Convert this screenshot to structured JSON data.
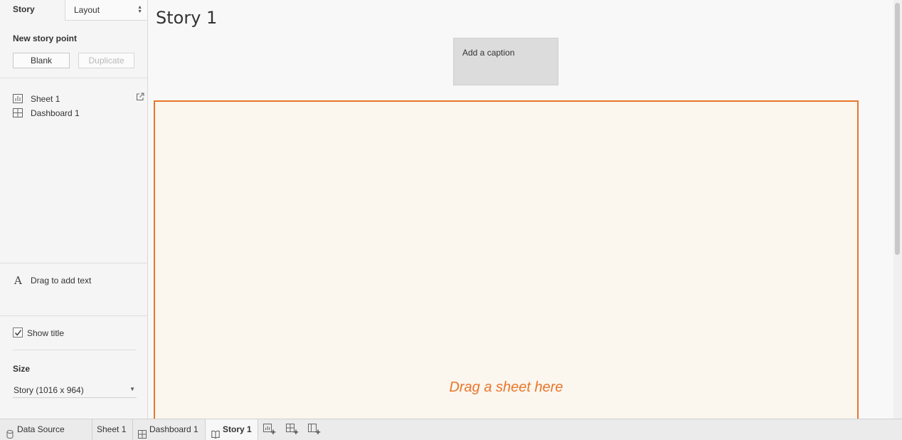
{
  "sidebar": {
    "tabs": {
      "story": "Story",
      "layout": "Layout"
    },
    "new_story_point": {
      "heading": "New story point",
      "blank_label": "Blank",
      "duplicate_label": "Duplicate"
    },
    "sheets": [
      {
        "label": "Sheet 1",
        "icon": "bar-chart-icon"
      },
      {
        "label": "Dashboard 1",
        "icon": "dashboard-grid-icon"
      }
    ],
    "text_object": {
      "glyph": "A",
      "label": "Drag to add text"
    },
    "show_title": {
      "label": "Show title",
      "checked": true
    },
    "size": {
      "heading": "Size",
      "selected": "Story (1016 x 964)"
    }
  },
  "main": {
    "title": "Story 1",
    "caption_placeholder": "Add a caption",
    "drop_zone_text": "Drag a sheet here"
  },
  "bottom_tabs": [
    {
      "label": "Data Source",
      "icon": "database-icon",
      "active": false
    },
    {
      "label": "Sheet 1",
      "icon": "",
      "active": false
    },
    {
      "label": "Dashboard 1",
      "icon": "dashboard-grid-icon",
      "active": false
    },
    {
      "label": "Story 1",
      "icon": "story-book-icon",
      "active": true
    }
  ],
  "new_buttons": [
    "new-worksheet-icon",
    "new-dashboard-icon",
    "new-story-icon"
  ],
  "colors": {
    "accent_orange": "#e8762b",
    "drop_zone_bg": "#fbf6ee",
    "caption_bg": "#dcdcdc"
  }
}
